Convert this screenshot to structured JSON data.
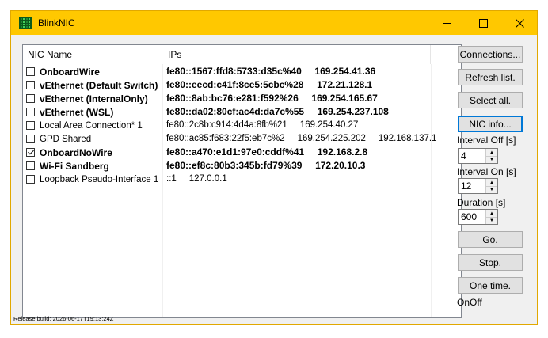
{
  "window": {
    "title": "BlinkNIC"
  },
  "list": {
    "columns": [
      "NIC Name",
      "IPs"
    ],
    "rows": [
      {
        "name": "OnboardWire",
        "ips": "fe80::1567:ffd8:5733:d35c%40     169.254.41.36",
        "checked": false,
        "bold": true
      },
      {
        "name": "vEthernet (Default Switch)",
        "ips": "fe80::eecd:c41f:8ce5:5cbc%28     172.21.128.1",
        "checked": false,
        "bold": true
      },
      {
        "name": "vEthernet (InternalOnly)",
        "ips": "fe80::8ab:bc76:e281:f592%26     169.254.165.67",
        "checked": false,
        "bold": true
      },
      {
        "name": "vEthernet (WSL)",
        "ips": "fe80::da02:80cf:ac4d:da7c%55     169.254.237.108",
        "checked": false,
        "bold": true
      },
      {
        "name": "Local Area Connection* 1",
        "ips": "fe80::2c8b:c914:4d4a:8fb%21     169.254.40.27",
        "checked": false,
        "bold": false
      },
      {
        "name": "GPD Shared",
        "ips": "fe80::ac85:f683:22f5:eb7c%2     169.254.225.202     192.168.137.1",
        "checked": false,
        "bold": false
      },
      {
        "name": "OnboardNoWire",
        "ips": "fe80::a470:e1d1:97e0:cddf%41     192.168.2.8",
        "checked": true,
        "bold": true
      },
      {
        "name": "Wi-Fi Sandberg",
        "ips": "fe80::ef8c:80b3:345b:fd79%39     172.20.10.3",
        "checked": false,
        "bold": true
      },
      {
        "name": "Loopback Pseudo-Interface 1",
        "ips": "::1     127.0.0.1",
        "checked": false,
        "bold": false
      }
    ]
  },
  "buttons": {
    "connections": "Connections...",
    "refresh": "Refresh list.",
    "select_all": "Select all.",
    "nic_info": "NIC info...",
    "go": "Go.",
    "stop": "Stop.",
    "one_time": "One time."
  },
  "settings": {
    "interval_off_label": "Interval Off [s]",
    "interval_off_value": "4",
    "interval_on_label": "Interval On [s]",
    "interval_on_value": "12",
    "duration_label": "Duration [s]",
    "duration_value": "600"
  },
  "state_text": "OnOff",
  "status_bar": "Release build: 2026-06-17T19:13:24Z"
}
